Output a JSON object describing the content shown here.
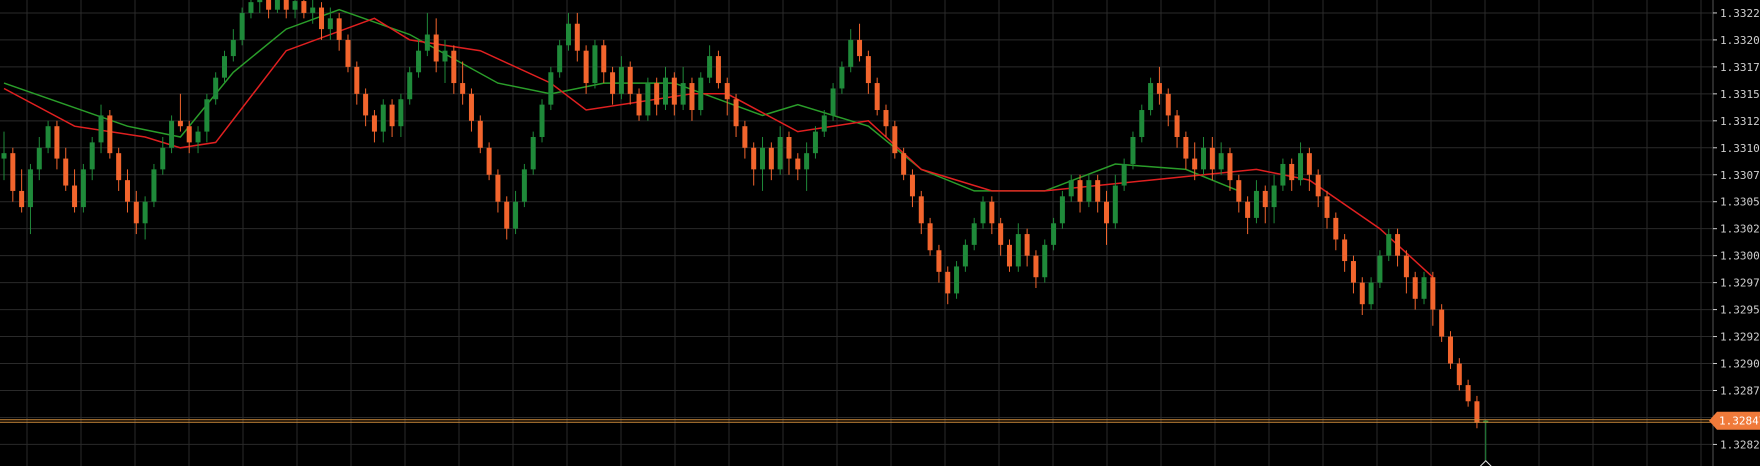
{
  "colors": {
    "background": "#000000",
    "grid": "#2a2a2a",
    "bull": "#1f8a3a",
    "bear": "#f2652d",
    "ma_green": "#2a9d2a",
    "ma_red": "#e02020",
    "price_line": "#cc8a3a",
    "tick_text": "#cfcfcf",
    "price_tag": "#f07a3a",
    "price_tag_text": "#ffffff"
  },
  "chart_data": {
    "type": "candlestick",
    "ylim": [
      1.32805,
      1.33237
    ],
    "y_ticks": [
      "1.33225",
      "1.33200",
      "1.33175",
      "1.33150",
      "1.33125",
      "1.33100",
      "1.33075",
      "1.33050",
      "1.33025",
      "1.33000",
      "1.32975",
      "1.32950",
      "1.32925",
      "1.32900",
      "1.32875",
      "1.32850",
      "1.32825"
    ],
    "current_price": "1.32847",
    "candles": [
      [
        1.3309,
        1.33115,
        1.3307,
        1.33095
      ],
      [
        1.33095,
        1.331,
        1.3305,
        1.3306
      ],
      [
        1.3306,
        1.3308,
        1.3304,
        1.33045
      ],
      [
        1.33045,
        1.33085,
        1.3302,
        1.3308
      ],
      [
        1.3308,
        1.3311,
        1.3307,
        1.331
      ],
      [
        1.331,
        1.33125,
        1.33095,
        1.3312
      ],
      [
        1.3312,
        1.33125,
        1.3308,
        1.3309
      ],
      [
        1.3309,
        1.331,
        1.3306,
        1.33065
      ],
      [
        1.33065,
        1.3308,
        1.3304,
        1.33045
      ],
      [
        1.33045,
        1.33085,
        1.3304,
        1.3308
      ],
      [
        1.3308,
        1.3311,
        1.3307,
        1.33105
      ],
      [
        1.33105,
        1.3314,
        1.33095,
        1.3313
      ],
      [
        1.3313,
        1.33135,
        1.3309,
        1.33095
      ],
      [
        1.33095,
        1.331,
        1.3306,
        1.3307
      ],
      [
        1.3307,
        1.3308,
        1.3304,
        1.3305
      ],
      [
        1.3305,
        1.3306,
        1.3302,
        1.3303
      ],
      [
        1.3303,
        1.33055,
        1.33015,
        1.3305
      ],
      [
        1.3305,
        1.33085,
        1.33045,
        1.3308
      ],
      [
        1.3308,
        1.3311,
        1.33075,
        1.331
      ],
      [
        1.331,
        1.3313,
        1.33095,
        1.33125
      ],
      [
        1.33125,
        1.3315,
        1.33115,
        1.3312
      ],
      [
        1.3312,
        1.33125,
        1.33095,
        1.33105
      ],
      [
        1.33105,
        1.3312,
        1.33095,
        1.33115
      ],
      [
        1.33115,
        1.3315,
        1.33105,
        1.33145
      ],
      [
        1.33145,
        1.3317,
        1.3314,
        1.33165
      ],
      [
        1.33165,
        1.3319,
        1.3316,
        1.33185
      ],
      [
        1.33185,
        1.3321,
        1.3318,
        1.332
      ],
      [
        1.332,
        1.3323,
        1.33195,
        1.33225
      ],
      [
        1.33225,
        1.3324,
        1.3322,
        1.33235
      ],
      [
        1.33235,
        1.3324,
        1.33225,
        1.3324
      ],
      [
        1.3324,
        1.3324,
        1.3322,
        1.33228
      ],
      [
        1.33228,
        1.3324,
        1.33225,
        1.3324
      ],
      [
        1.3324,
        1.3324,
        1.3322,
        1.33228
      ],
      [
        1.33228,
        1.3324,
        1.3322,
        1.33236
      ],
      [
        1.33236,
        1.3324,
        1.3322,
        1.33225
      ],
      [
        1.33225,
        1.3324,
        1.33215,
        1.3323
      ],
      [
        1.3323,
        1.33235,
        1.332,
        1.3321
      ],
      [
        1.3321,
        1.3323,
        1.332,
        1.3322
      ],
      [
        1.3322,
        1.33225,
        1.3319,
        1.332
      ],
      [
        1.332,
        1.33205,
        1.3317,
        1.33175
      ],
      [
        1.33175,
        1.3318,
        1.3314,
        1.3315
      ],
      [
        1.3315,
        1.33155,
        1.3312,
        1.3313
      ],
      [
        1.3313,
        1.33135,
        1.33105,
        1.33115
      ],
      [
        1.33115,
        1.33145,
        1.33105,
        1.3314
      ],
      [
        1.3314,
        1.33145,
        1.3311,
        1.3312
      ],
      [
        1.3312,
        1.3315,
        1.3311,
        1.33145
      ],
      [
        1.33145,
        1.33175,
        1.3314,
        1.3317
      ],
      [
        1.3317,
        1.332,
        1.33165,
        1.3319
      ],
      [
        1.3319,
        1.33225,
        1.33185,
        1.33205
      ],
      [
        1.33205,
        1.3322,
        1.3317,
        1.3318
      ],
      [
        1.3318,
        1.332,
        1.3316,
        1.3319
      ],
      [
        1.3319,
        1.33195,
        1.3315,
        1.3316
      ],
      [
        1.3316,
        1.3318,
        1.3314,
        1.3315
      ],
      [
        1.3315,
        1.33155,
        1.33115,
        1.33125
      ],
      [
        1.33125,
        1.3313,
        1.33095,
        1.331
      ],
      [
        1.331,
        1.33105,
        1.3307,
        1.33075
      ],
      [
        1.33075,
        1.3308,
        1.3304,
        1.3305
      ],
      [
        1.3305,
        1.33055,
        1.33015,
        1.33025
      ],
      [
        1.33025,
        1.3306,
        1.3302,
        1.3305
      ],
      [
        1.3305,
        1.33085,
        1.33045,
        1.3308
      ],
      [
        1.3308,
        1.33115,
        1.33075,
        1.3311
      ],
      [
        1.3311,
        1.33145,
        1.33105,
        1.3314
      ],
      [
        1.3314,
        1.33175,
        1.33135,
        1.3317
      ],
      [
        1.3317,
        1.332,
        1.33165,
        1.33195
      ],
      [
        1.33195,
        1.33225,
        1.3319,
        1.33215
      ],
      [
        1.33215,
        1.33225,
        1.3318,
        1.3319
      ],
      [
        1.3319,
        1.33195,
        1.3315,
        1.3316
      ],
      [
        1.3316,
        1.332,
        1.33155,
        1.33195
      ],
      [
        1.33195,
        1.332,
        1.3316,
        1.3317
      ],
      [
        1.3317,
        1.33175,
        1.3314,
        1.3315
      ],
      [
        1.3315,
        1.33185,
        1.33145,
        1.33175
      ],
      [
        1.33175,
        1.3318,
        1.3314,
        1.3315
      ],
      [
        1.3315,
        1.33155,
        1.33125,
        1.3313
      ],
      [
        1.3313,
        1.33165,
        1.33125,
        1.3316
      ],
      [
        1.3316,
        1.33165,
        1.3313,
        1.3314
      ],
      [
        1.3314,
        1.33175,
        1.33135,
        1.33165
      ],
      [
        1.33165,
        1.3317,
        1.3313,
        1.3314
      ],
      [
        1.3314,
        1.33175,
        1.33135,
        1.3316
      ],
      [
        1.3316,
        1.33165,
        1.33125,
        1.33135
      ],
      [
        1.33135,
        1.3317,
        1.3313,
        1.33165
      ],
      [
        1.33165,
        1.33195,
        1.3316,
        1.33185
      ],
      [
        1.33185,
        1.3319,
        1.33155,
        1.3316
      ],
      [
        1.3316,
        1.33165,
        1.3313,
        1.33145
      ],
      [
        1.33145,
        1.3315,
        1.3311,
        1.3312
      ],
      [
        1.3312,
        1.33125,
        1.3309,
        1.331
      ],
      [
        1.331,
        1.33105,
        1.33065,
        1.3308
      ],
      [
        1.3308,
        1.3311,
        1.3306,
        1.331
      ],
      [
        1.331,
        1.33105,
        1.3307,
        1.3308
      ],
      [
        1.3308,
        1.3312,
        1.33075,
        1.3311
      ],
      [
        1.3311,
        1.33115,
        1.33075,
        1.3309
      ],
      [
        1.3309,
        1.33095,
        1.3307,
        1.3308
      ],
      [
        1.3308,
        1.33105,
        1.3306,
        1.33095
      ],
      [
        1.33095,
        1.3312,
        1.3309,
        1.33115
      ],
      [
        1.33115,
        1.33135,
        1.3311,
        1.3313
      ],
      [
        1.3313,
        1.3316,
        1.33125,
        1.33155
      ],
      [
        1.33155,
        1.3318,
        1.3315,
        1.33175
      ],
      [
        1.33175,
        1.3321,
        1.3317,
        1.332
      ],
      [
        1.332,
        1.33215,
        1.3318,
        1.33185
      ],
      [
        1.33185,
        1.3319,
        1.3315,
        1.3316
      ],
      [
        1.3316,
        1.33165,
        1.3313,
        1.33135
      ],
      [
        1.33135,
        1.3314,
        1.3311,
        1.3312
      ],
      [
        1.3312,
        1.33125,
        1.3309,
        1.33095
      ],
      [
        1.33095,
        1.331,
        1.3307,
        1.33075
      ],
      [
        1.33075,
        1.3308,
        1.33045,
        1.33055
      ],
      [
        1.33055,
        1.3306,
        1.3302,
        1.3303
      ],
      [
        1.3303,
        1.33035,
        1.33,
        1.33005
      ],
      [
        1.33005,
        1.3301,
        1.32975,
        1.32985
      ],
      [
        1.32985,
        1.3299,
        1.32955,
        1.32965
      ],
      [
        1.32965,
        1.32995,
        1.3296,
        1.3299
      ],
      [
        1.3299,
        1.33015,
        1.32985,
        1.3301
      ],
      [
        1.3301,
        1.33035,
        1.33005,
        1.3303
      ],
      [
        1.3303,
        1.33055,
        1.33025,
        1.3305
      ],
      [
        1.3305,
        1.33055,
        1.3302,
        1.3303
      ],
      [
        1.3303,
        1.33035,
        1.33,
        1.3301
      ],
      [
        1.3301,
        1.33015,
        1.32985,
        1.3299
      ],
      [
        1.3299,
        1.3303,
        1.32985,
        1.3302
      ],
      [
        1.3302,
        1.33025,
        1.3299,
        1.33
      ],
      [
        1.33,
        1.33005,
        1.3297,
        1.3298
      ],
      [
        1.3298,
        1.33015,
        1.32975,
        1.3301
      ],
      [
        1.3301,
        1.33035,
        1.33005,
        1.3303
      ],
      [
        1.3303,
        1.3306,
        1.33025,
        1.33055
      ],
      [
        1.33055,
        1.33075,
        1.3305,
        1.3307
      ],
      [
        1.3307,
        1.33075,
        1.3304,
        1.3305
      ],
      [
        1.3305,
        1.33075,
        1.33045,
        1.3307
      ],
      [
        1.3307,
        1.33075,
        1.3304,
        1.3305
      ],
      [
        1.3305,
        1.3306,
        1.3301,
        1.3303
      ],
      [
        1.3303,
        1.33075,
        1.33025,
        1.33065
      ],
      [
        1.33065,
        1.3309,
        1.3306,
        1.33085
      ],
      [
        1.33085,
        1.33115,
        1.3308,
        1.3311
      ],
      [
        1.3311,
        1.3314,
        1.33105,
        1.33135
      ],
      [
        1.33135,
        1.33165,
        1.3313,
        1.3316
      ],
      [
        1.3316,
        1.33175,
        1.3314,
        1.3315
      ],
      [
        1.3315,
        1.33155,
        1.3312,
        1.3313
      ],
      [
        1.3313,
        1.33135,
        1.331,
        1.3311
      ],
      [
        1.3311,
        1.33115,
        1.3308,
        1.3309
      ],
      [
        1.3309,
        1.33105,
        1.3307,
        1.3308
      ],
      [
        1.3308,
        1.3311,
        1.33075,
        1.331
      ],
      [
        1.331,
        1.3311,
        1.3307,
        1.3308
      ],
      [
        1.3308,
        1.33105,
        1.33075,
        1.33095
      ],
      [
        1.33095,
        1.331,
        1.3306,
        1.3307
      ],
      [
        1.3307,
        1.33075,
        1.3304,
        1.3305
      ],
      [
        1.3305,
        1.33055,
        1.3302,
        1.33035
      ],
      [
        1.33035,
        1.3307,
        1.3303,
        1.3306
      ],
      [
        1.3306,
        1.33065,
        1.3303,
        1.33045
      ],
      [
        1.33045,
        1.33075,
        1.3303,
        1.33065
      ],
      [
        1.33065,
        1.3309,
        1.3306,
        1.33085
      ],
      [
        1.33085,
        1.3309,
        1.3306,
        1.3307
      ],
      [
        1.3307,
        1.33105,
        1.33065,
        1.33095
      ],
      [
        1.33095,
        1.331,
        1.3306,
        1.33075
      ],
      [
        1.33075,
        1.3308,
        1.33045,
        1.33055
      ],
      [
        1.33055,
        1.3306,
        1.33025,
        1.33035
      ],
      [
        1.33035,
        1.3304,
        1.33005,
        1.33015
      ],
      [
        1.33015,
        1.3302,
        1.32985,
        1.32995
      ],
      [
        1.32995,
        1.33,
        1.32965,
        1.32975
      ],
      [
        1.32975,
        1.3298,
        1.32945,
        1.32955
      ],
      [
        1.32955,
        1.3298,
        1.3295,
        1.32975
      ],
      [
        1.32975,
        1.33005,
        1.3297,
        1.33
      ],
      [
        1.33,
        1.33025,
        1.32995,
        1.3302
      ],
      [
        1.3302,
        1.33025,
        1.3299,
        1.33
      ],
      [
        1.33,
        1.33005,
        1.32965,
        1.3298
      ],
      [
        1.3298,
        1.32985,
        1.3295,
        1.3296
      ],
      [
        1.3296,
        1.32985,
        1.32955,
        1.3298
      ],
      [
        1.3298,
        1.32985,
        1.32935,
        1.3295
      ],
      [
        1.3295,
        1.32955,
        1.3292,
        1.32925
      ],
      [
        1.32925,
        1.3293,
        1.32895,
        1.329
      ],
      [
        1.329,
        1.32905,
        1.32875,
        1.3288
      ],
      [
        1.3288,
        1.32885,
        1.3286,
        1.32865
      ],
      [
        1.32865,
        1.3287,
        1.3284,
        1.32845
      ],
      [
        1.32845,
        1.32848,
        1.32808,
        1.32847
      ]
    ],
    "ma_red": [
      [
        0,
        1.33155
      ],
      [
        8,
        1.3312
      ],
      [
        16,
        1.3311
      ],
      [
        20,
        1.331
      ],
      [
        24,
        1.33105
      ],
      [
        32,
        1.3319
      ],
      [
        42,
        1.3322
      ],
      [
        46,
        1.332
      ],
      [
        54,
        1.3319
      ],
      [
        62,
        1.3316
      ],
      [
        66,
        1.33135
      ],
      [
        78,
        1.3315
      ],
      [
        82,
        1.3315
      ],
      [
        90,
        1.33115
      ],
      [
        98,
        1.33125
      ],
      [
        104,
        1.3308
      ],
      [
        112,
        1.3306
      ],
      [
        118,
        1.3306
      ],
      [
        130,
        1.3307
      ],
      [
        142,
        1.3308
      ],
      [
        148,
        1.3307
      ],
      [
        156,
        1.33025
      ],
      [
        162,
        1.3298
      ]
    ],
    "ma_green": [
      [
        0,
        1.3316
      ],
      [
        14,
        1.3312
      ],
      [
        20,
        1.3311
      ],
      [
        26,
        1.3317
      ],
      [
        32,
        1.3321
      ],
      [
        38,
        1.33228
      ],
      [
        46,
        1.33205
      ],
      [
        56,
        1.3316
      ],
      [
        62,
        1.3315
      ],
      [
        68,
        1.3316
      ],
      [
        76,
        1.3316
      ],
      [
        86,
        1.3313
      ],
      [
        90,
        1.3314
      ],
      [
        98,
        1.3312
      ],
      [
        104,
        1.3308
      ],
      [
        110,
        1.3306
      ],
      [
        118,
        1.3306
      ],
      [
        126,
        1.33085
      ],
      [
        134,
        1.3308
      ],
      [
        140,
        1.3306
      ]
    ]
  }
}
